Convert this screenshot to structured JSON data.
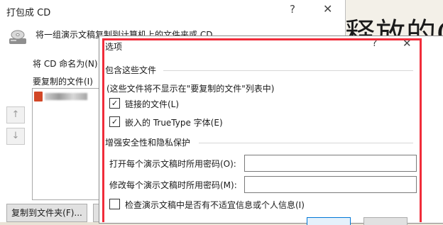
{
  "slide": {
    "text": "释放的C"
  },
  "package_dialog": {
    "title": "打包成 CD",
    "help_glyph": "?",
    "close_glyph": "✕",
    "description": "将一组演示文稿复制到计算机上的文件夹或 CD。",
    "cd_name_label": "将 CD 命名为(N)",
    "files_label": "要复制的文件(I)",
    "up_arrow": "↑",
    "down_arrow": "↓",
    "copy_to_folder_button": "复制到文件夹(F)...",
    "second_button": ""
  },
  "options_dialog": {
    "title": "选项",
    "help_glyph": "?",
    "close_glyph": "✕",
    "include_section": "包含这些文件",
    "include_note": "(这些文件将不显示在\"要复制的文件\"列表中)",
    "checkboxes": [
      {
        "label": "链接的文件(L)",
        "checked": true
      },
      {
        "label": "嵌入的 TrueType 字体(E)",
        "checked": true
      }
    ],
    "security_section": "增强安全性和隐私保护",
    "open_password_label": "打开每个演示文稿时所用密码(O):",
    "open_password_value": "",
    "modify_password_label": "修改每个演示文稿时所用密码(M):",
    "modify_password_value": "",
    "inspect_checkbox": {
      "label": "检查演示文稿中是否有不适宜信息或个人信息(I)",
      "checked": false
    }
  },
  "colors": {
    "highlight_border": "#f02c3a"
  }
}
